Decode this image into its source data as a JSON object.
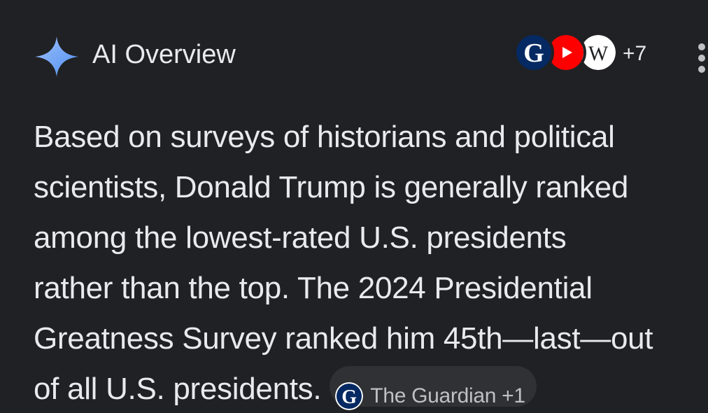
{
  "header": {
    "title": "AI Overview",
    "sparkle_icon": "sparkle-icon",
    "sources": [
      {
        "name": "guardian-logo-icon",
        "letter": "G",
        "color": "#052962"
      },
      {
        "name": "youtube-logo-icon",
        "color": "#ff0000"
      },
      {
        "name": "wikipedia-logo-icon",
        "letter": "W",
        "color": "#ffffff"
      }
    ],
    "more_sources": "+7",
    "menu_icon": "more-vert-icon"
  },
  "overview": {
    "lines": [
      "Based on surveys of historians and political",
      "scientists, Donald Trump is generally ranked",
      "among the lowest-rated U.S. presidents",
      "rather than the top. The 2024 Presidential",
      "Greatness Survey ranked him 45th—last—out",
      "of all U.S. presidents."
    ],
    "citation": {
      "icon_letter": "G",
      "label": "The Guardian +1"
    }
  },
  "colors": {
    "background": "#202124",
    "text": "#e8eaed",
    "sparkle_blue": "#8ab4f8",
    "chip_bg": "#303134",
    "guardian_blue": "#052962",
    "youtube_red": "#ff0000"
  }
}
